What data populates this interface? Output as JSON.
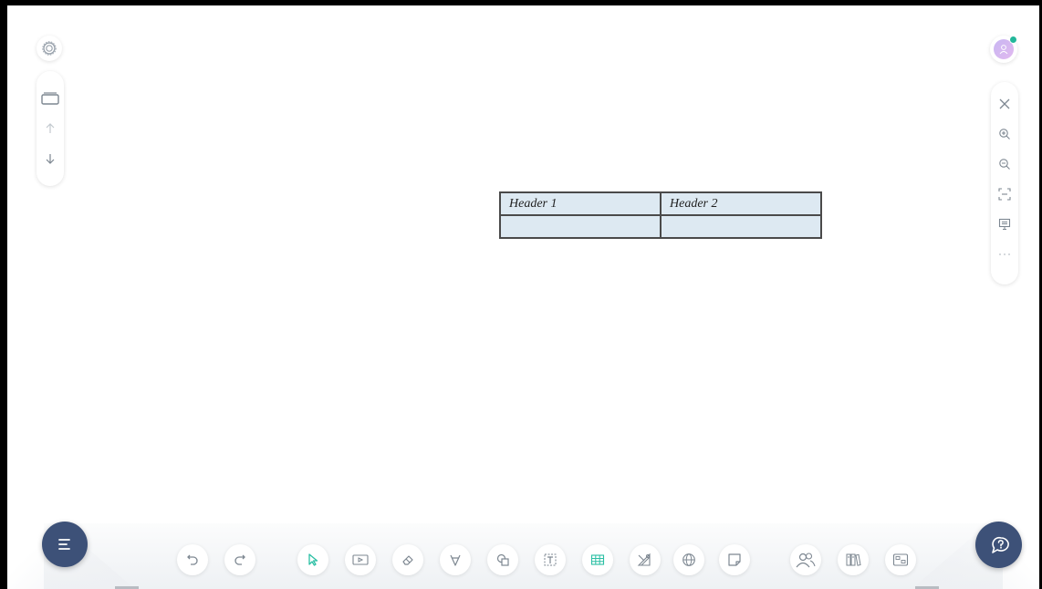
{
  "board": {
    "table": {
      "header_1": "Header 1",
      "header_2": "Header 2",
      "row_1_col_1": "",
      "row_1_col_2": ""
    }
  },
  "colors": {
    "fab": "#3d5178",
    "accent": "#2bbfa4",
    "icon": "#9aa3ad",
    "table_fill": "#dde9f2"
  },
  "icons": {
    "left_panel": [
      "settings-icon",
      "page-icon",
      "arrow-up-icon",
      "arrow-down-icon"
    ],
    "right_panel": [
      "avatar-icon",
      "close-icon",
      "zoom-in-icon",
      "zoom-out-icon",
      "fit-screen-icon",
      "present-icon",
      "more-icon"
    ],
    "bottom_toolbar": [
      "undo-icon",
      "redo-icon",
      "select-icon",
      "media-icon",
      "eraser-icon",
      "pen-icon",
      "shapes-icon",
      "text-icon",
      "table-icon",
      "geometry-icon",
      "browser-icon",
      "sticky-note-icon",
      "participants-icon",
      "library-icon",
      "image-icon",
      "menu-icon",
      "help-chat-icon"
    ]
  }
}
